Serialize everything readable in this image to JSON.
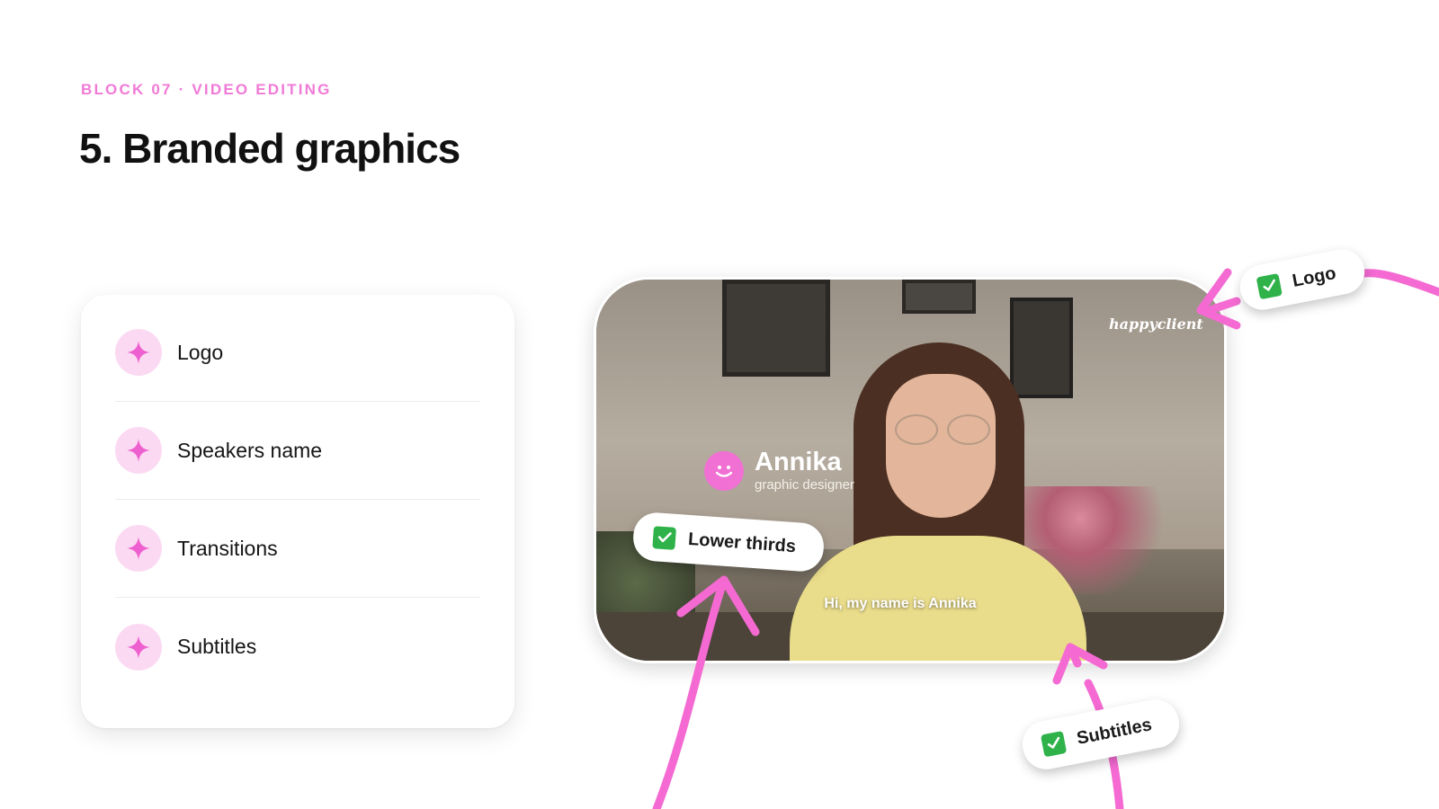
{
  "header": {
    "eyebrow": "BLOCK 07 · VIDEO EDITING",
    "title": "5. Branded graphics"
  },
  "features": {
    "items": [
      {
        "label": "Logo",
        "icon": "sparkle-icon"
      },
      {
        "label": "Speakers name",
        "icon": "sparkle-icon"
      },
      {
        "label": "Transitions",
        "icon": "sparkle-icon"
      },
      {
        "label": "Subtitles",
        "icon": "sparkle-icon"
      }
    ]
  },
  "video": {
    "logo_text": "happyclient",
    "speaker_name": "Annika",
    "speaker_role": "graphic designer",
    "subtitle": "Hi, my name is Annika"
  },
  "callouts": {
    "logo": "Logo",
    "lower_thirds": "Lower thirds",
    "subtitles": "Subtitles"
  },
  "colors": {
    "accent_pink": "#f07ad6",
    "check_green": "#2fb24a",
    "sparkle_bg": "#fbd9f2",
    "sparkle": "#ee5fcf",
    "arrow_pink": "#f46ad2"
  }
}
